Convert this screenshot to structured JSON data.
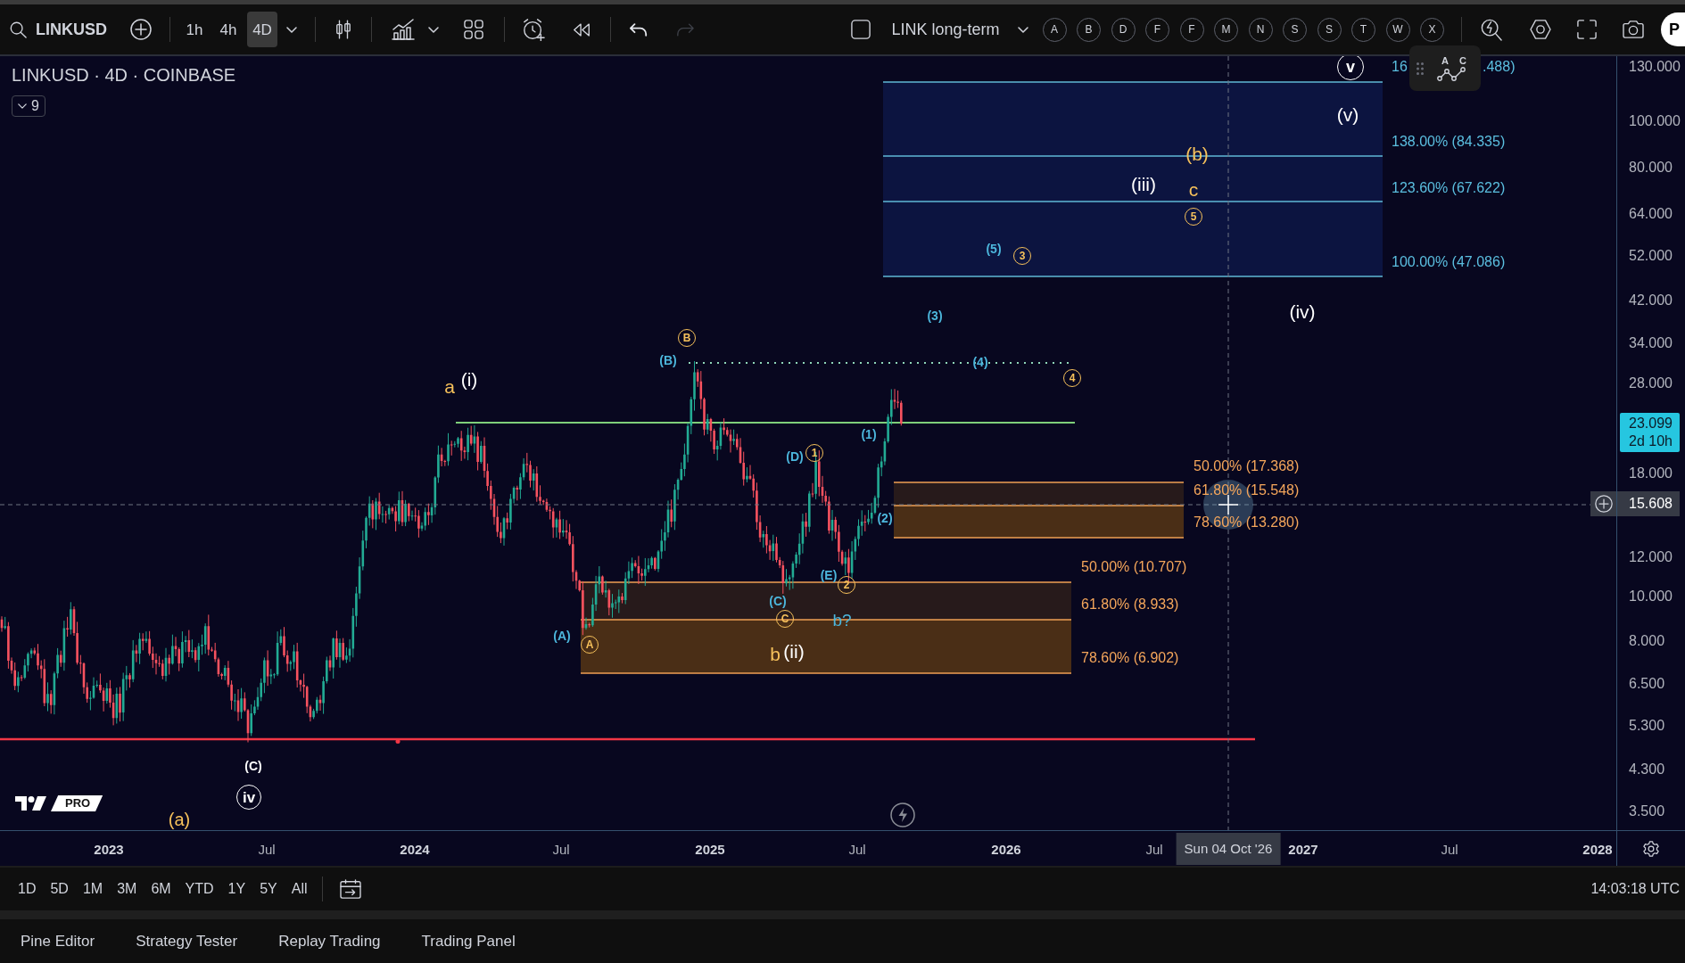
{
  "toolbar": {
    "symbol": "LINKUSD",
    "intervals": [
      {
        "label": "1h",
        "selected": false
      },
      {
        "label": "4h",
        "selected": false
      },
      {
        "label": "4D",
        "selected": true
      }
    ],
    "history_buttons": [
      {
        "kind": "undo",
        "disabled": false
      },
      {
        "kind": "redo",
        "disabled": true
      }
    ],
    "layout_name": "LINK long-term",
    "letter_buttons": [
      "A",
      "B",
      "D",
      "F",
      "F",
      "M",
      "N",
      "S",
      "S",
      "T",
      "W",
      "X"
    ],
    "publish_label": "P"
  },
  "legend": {
    "title": "LINKUSD · 4D · COINBASE",
    "indicators_toggle": "9"
  },
  "drawing_toolbar": {
    "tool_letters": [
      "A",
      "C"
    ]
  },
  "chart": {
    "fib_tools": [
      {
        "kind": "extension",
        "levels": [
          {
            "parts": [
              "16",
              ".488)"
            ]
          },
          {
            "parts": [
              "138.00% (84.335)"
            ]
          },
          {
            "parts": [
              "123.60% (67.622)"
            ]
          },
          {
            "parts": [
              "100.00% (47.086)"
            ]
          }
        ]
      },
      {
        "kind": "retracement",
        "levels": [
          {
            "parts": [
              "50.00% (17.368)"
            ]
          },
          {
            "parts": [
              "61.80% (15.548)"
            ]
          },
          {
            "parts": [
              "78.60% (13.280)"
            ]
          }
        ]
      },
      {
        "kind": "retracement",
        "levels": [
          {
            "parts": [
              "50.00% (10.707)"
            ]
          },
          {
            "parts": [
              "61.80% (8.933)"
            ]
          },
          {
            "parts": [
              "78.60% (6.902)"
            ]
          }
        ]
      }
    ],
    "wave_labels": [
      {
        "text": "v",
        "kind": "circled",
        "color": "#ffffff"
      },
      {
        "text": "(v)",
        "kind": "plain",
        "color": "#ffffff"
      },
      {
        "text": "(b)",
        "kind": "plain",
        "color": "#f6c15b"
      },
      {
        "text": "(iii)",
        "kind": "plain",
        "color": "#ffffff"
      },
      {
        "text": "c",
        "kind": "plain",
        "color": "#f6c15b"
      },
      {
        "text": "5",
        "kind": "circled",
        "color": "#f6c15b"
      },
      {
        "text": "(5)",
        "kind": "plain",
        "color": "#4cb6dc"
      },
      {
        "text": "3",
        "kind": "circled",
        "color": "#f6c15b"
      },
      {
        "text": "(3)",
        "kind": "plain",
        "color": "#4cb6dc"
      },
      {
        "text": "(iv)",
        "kind": "plain",
        "color": "#ffffff"
      },
      {
        "text": "B",
        "kind": "circled",
        "color": "#f6c15b"
      },
      {
        "text": "(B)",
        "kind": "plain",
        "color": "#4cb6dc"
      },
      {
        "text": "(4)",
        "kind": "plain",
        "color": "#4cb6dc"
      },
      {
        "text": "a",
        "kind": "plain",
        "color": "#f6c15b"
      },
      {
        "text": "(i)",
        "kind": "plain",
        "color": "#ffffff"
      },
      {
        "text": "4",
        "kind": "circled",
        "color": "#f6c15b"
      },
      {
        "text": "(1)",
        "kind": "plain",
        "color": "#4cb6dc"
      },
      {
        "text": "(D)",
        "kind": "plain",
        "color": "#4cb6dc"
      },
      {
        "text": "1",
        "kind": "circled",
        "color": "#f6c15b"
      },
      {
        "text": "(2)",
        "kind": "plain",
        "color": "#4cb6dc"
      },
      {
        "text": "(E)",
        "kind": "plain",
        "color": "#4cb6dc"
      },
      {
        "text": "2",
        "kind": "circled",
        "color": "#f6c15b"
      },
      {
        "text": "(C)",
        "kind": "plain",
        "color": "#4cb6dc"
      },
      {
        "text": "C",
        "kind": "circled",
        "color": "#f6c15b"
      },
      {
        "text": "b?",
        "kind": "plain",
        "color": "#4cb6dc"
      },
      {
        "text": "(A)",
        "kind": "plain",
        "color": "#4cb6dc"
      },
      {
        "text": "A",
        "kind": "circled",
        "color": "#f6c15b"
      },
      {
        "text": "b",
        "kind": "plain",
        "color": "#f6c15b"
      },
      {
        "text": "(ii)",
        "kind": "plain",
        "color": "#ffffff"
      },
      {
        "text": "(C)",
        "kind": "plain",
        "color": "#ffffff"
      },
      {
        "text": "iv",
        "kind": "circled",
        "color": "#ffffff"
      },
      {
        "text": "(a)",
        "kind": "plain",
        "color": "#f6c15b"
      }
    ],
    "logo_badge": "PRO"
  },
  "price_axis": {
    "labels": [
      "130.000",
      "100.000",
      "80.000",
      "64.000",
      "52.000",
      "42.000",
      "34.000",
      "28.000",
      "18.000",
      "12.000",
      "10.000",
      "8.000",
      "6.500",
      "5.300",
      "4.300",
      "3.500"
    ],
    "last_price": "23.099",
    "countdown": "2d 10h",
    "crosshair_price": "15.608"
  },
  "time_axis": {
    "labels": [
      {
        "text": "2023",
        "kind": "year"
      },
      {
        "text": "Jul",
        "kind": "month"
      },
      {
        "text": "2024",
        "kind": "year"
      },
      {
        "text": "Jul",
        "kind": "month"
      },
      {
        "text": "2025",
        "kind": "year"
      },
      {
        "text": "Jul",
        "kind": "month"
      },
      {
        "text": "2026",
        "kind": "year"
      },
      {
        "text": "Jul",
        "kind": "month"
      },
      {
        "text": "2027",
        "kind": "year"
      },
      {
        "text": "Jul",
        "kind": "month"
      },
      {
        "text": "2028",
        "kind": "year"
      }
    ],
    "crosshair_date": "Sun 04 Oct '26"
  },
  "range_bar": {
    "ranges": [
      "1D",
      "5D",
      "1M",
      "3M",
      "6M",
      "YTD",
      "1Y",
      "5Y",
      "All"
    ],
    "clock": "14:03:18 UTC"
  },
  "bottom_tabs": [
    {
      "label": "Pine Editor",
      "selected": false
    },
    {
      "label": "Strategy Tester",
      "selected": false
    },
    {
      "label": "Replay Trading",
      "selected": false
    },
    {
      "label": "Trading Panel",
      "selected": false
    }
  ]
}
